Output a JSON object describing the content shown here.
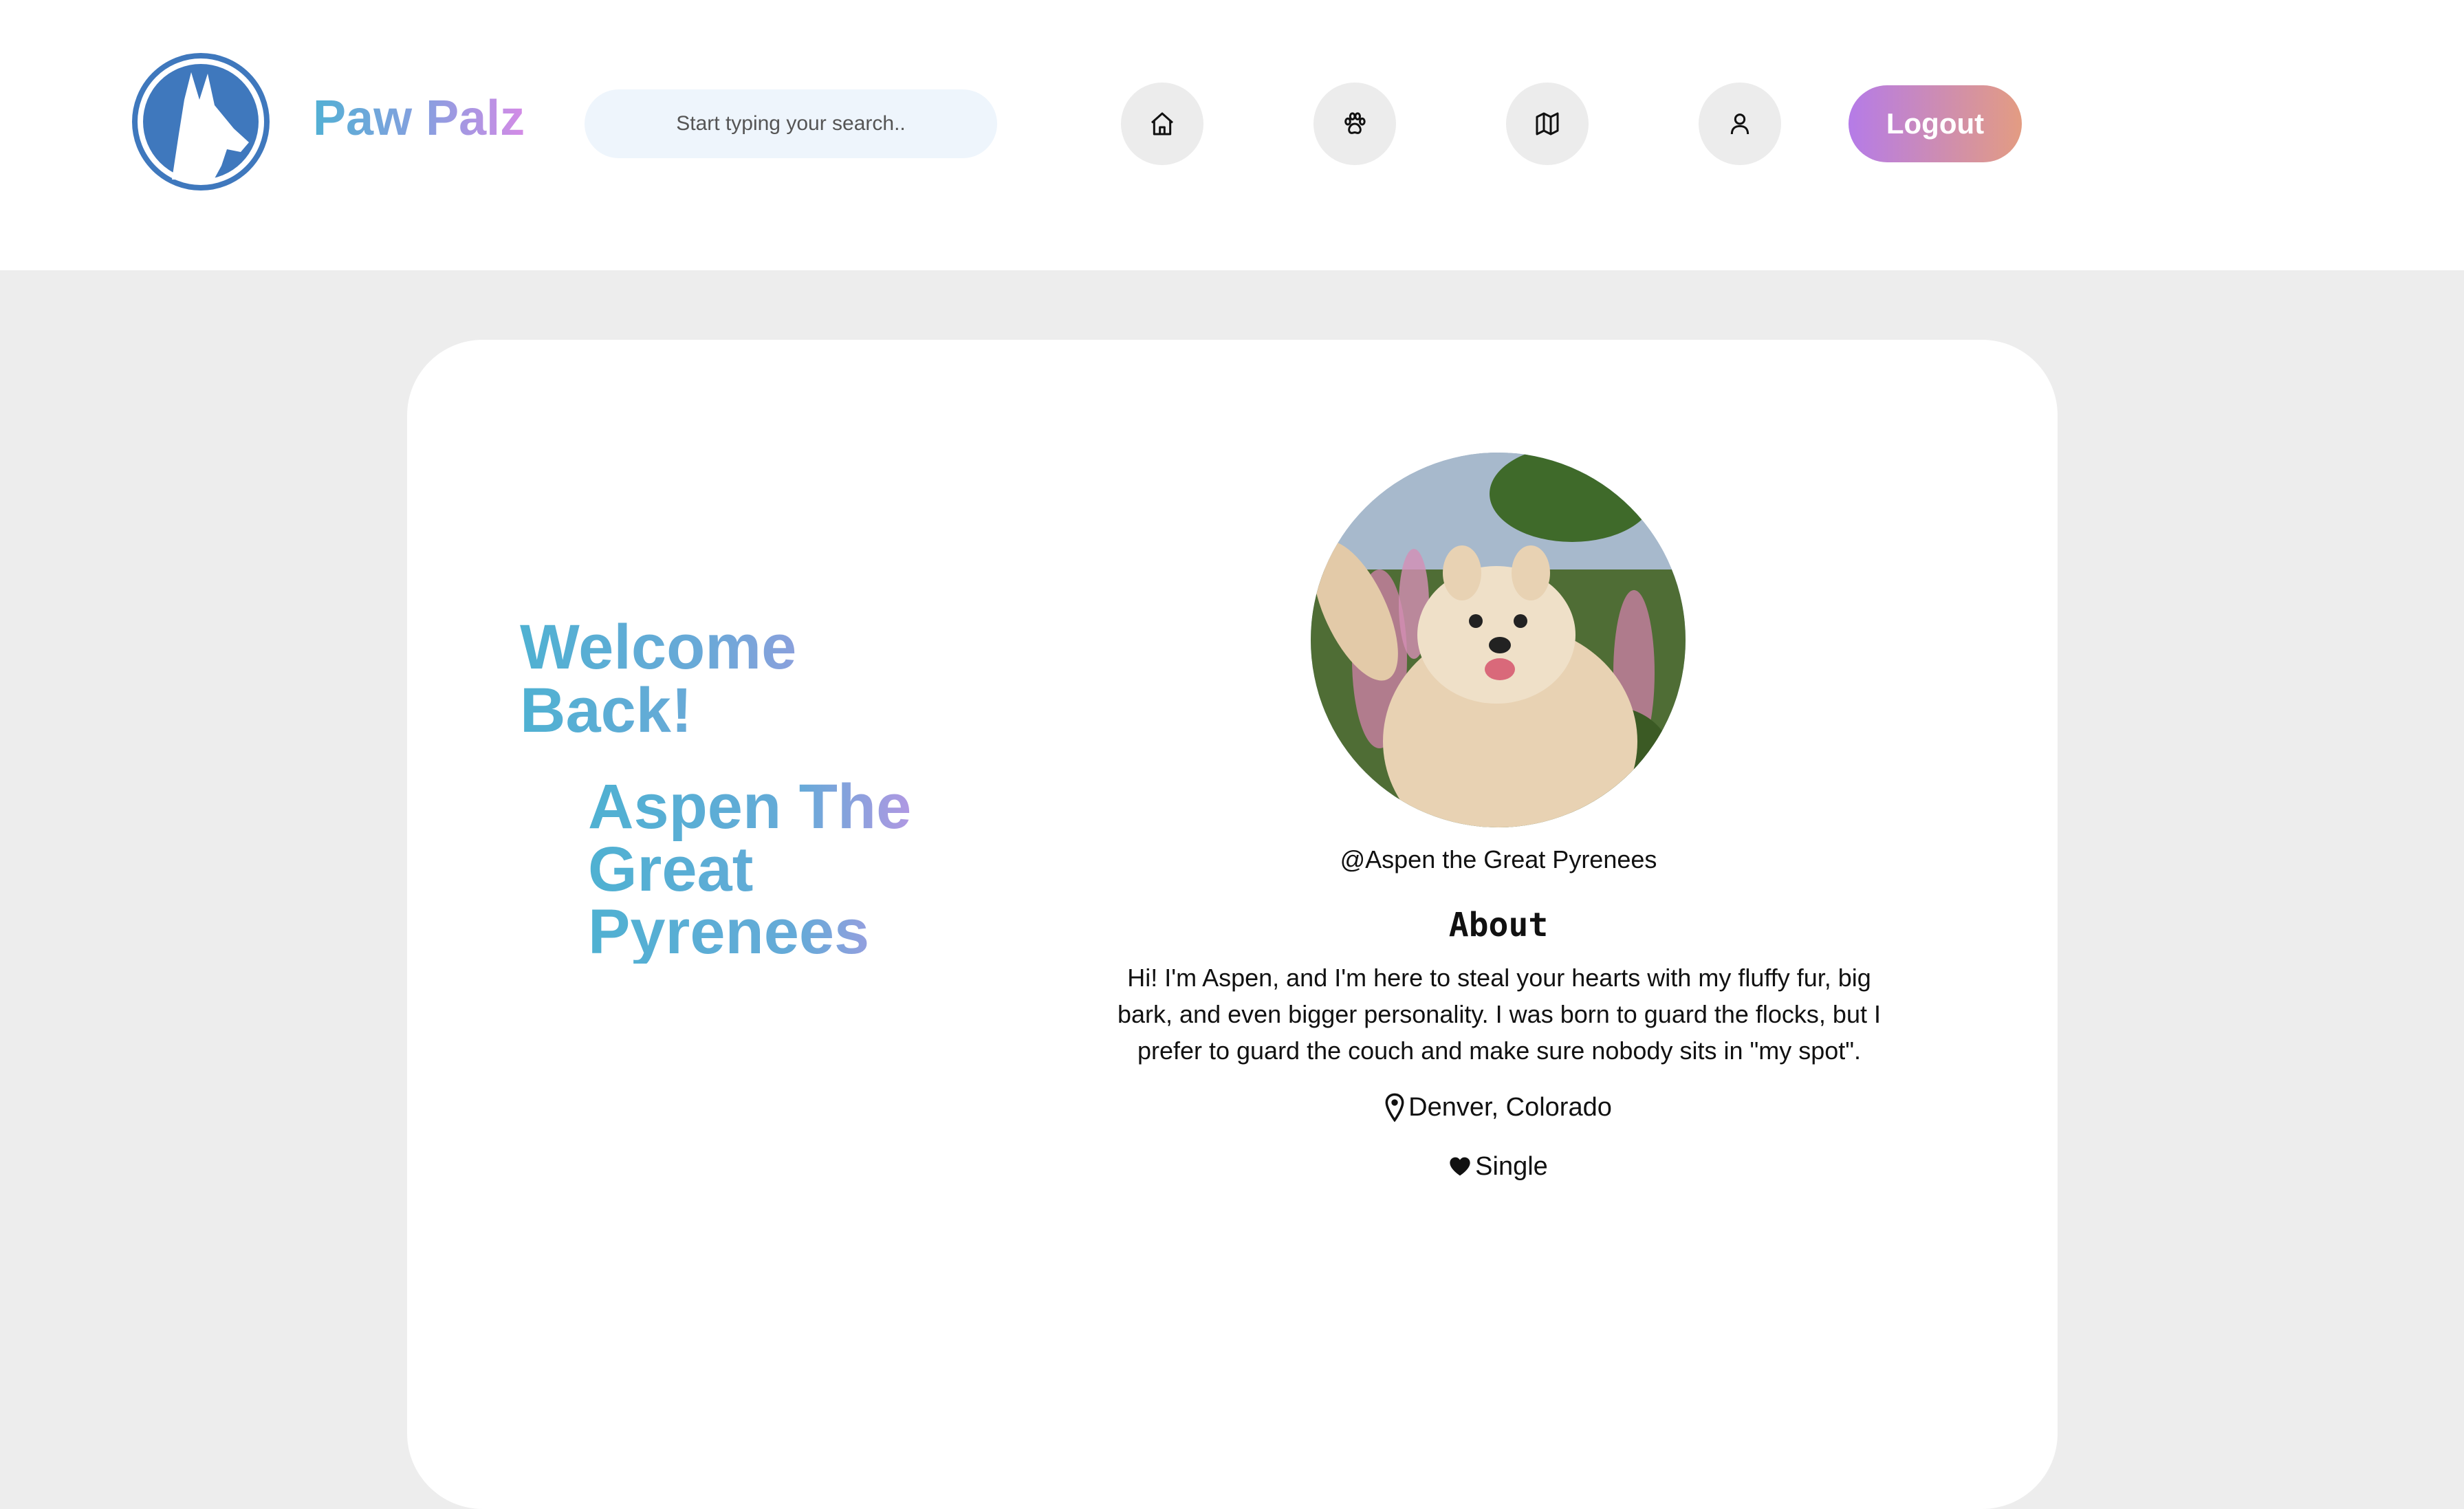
{
  "header": {
    "brand": "Paw Palz",
    "search_placeholder": "Start typing your search..",
    "nav": [
      {
        "icon": "home-icon"
      },
      {
        "icon": "paw-icon"
      },
      {
        "icon": "map-icon"
      },
      {
        "icon": "user-icon"
      }
    ],
    "logout_label": "Logout"
  },
  "profile": {
    "welcome": "Welcome Back!",
    "name": "Aspen The Great Pyrenees",
    "handle": "@Aspen the Great Pyrenees",
    "about_title": "About",
    "about_text": "Hi! I'm Aspen, and I'm here to steal your hearts with my fluffy fur, big bark, and even bigger personality. I was born to guard the flocks, but I prefer to guard the couch and make sure nobody sits in \"my spot\".",
    "location": "Denver, Colorado",
    "status": "Single"
  },
  "colors": {
    "brand_gradient_start": "#52b0d4",
    "brand_gradient_end": "#d48be6",
    "logout_gradient_start": "#b57be8",
    "logout_gradient_end": "#e39c82",
    "logo_blue": "#3f78bd",
    "page_background": "#ededed"
  }
}
